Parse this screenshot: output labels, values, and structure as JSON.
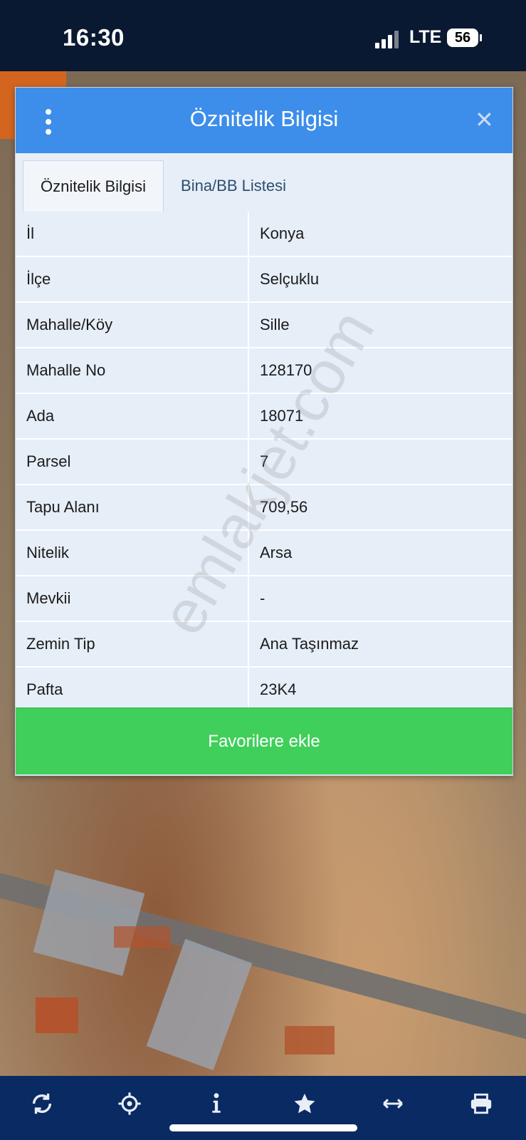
{
  "status_bar": {
    "time": "16:30",
    "network": "LTE",
    "battery": "56"
  },
  "dialog": {
    "title": "Öznitelik Bilgisi",
    "tabs": [
      {
        "label": "Öznitelik Bilgisi",
        "active": true
      },
      {
        "label": "Bina/BB Listesi",
        "active": false
      }
    ],
    "rows": [
      {
        "key": "İl",
        "value": "Konya"
      },
      {
        "key": "İlçe",
        "value": "Selçuklu"
      },
      {
        "key": "Mahalle/Köy",
        "value": "Sille"
      },
      {
        "key": "Mahalle No",
        "value": "128170"
      },
      {
        "key": "Ada",
        "value": "18071"
      },
      {
        "key": "Parsel",
        "value": "7"
      },
      {
        "key": "Tapu Alanı",
        "value": "709,56"
      },
      {
        "key": "Nitelik",
        "value": "Arsa"
      },
      {
        "key": "Mevkii",
        "value": "-"
      },
      {
        "key": "Zemin Tip",
        "value": "Ana Taşınmaz"
      },
      {
        "key": "Pafta",
        "value": "23K4"
      }
    ],
    "button_label": "Favorilere ekle",
    "watermark": "emlakjet.com"
  },
  "toolbar": {
    "icons": [
      "refresh-icon",
      "locate-icon",
      "info-icon",
      "star-icon",
      "measure-icon",
      "print-icon"
    ]
  },
  "colors": {
    "header": "#3d8eea",
    "button": "#3fcf5a",
    "toolbar": "#0a2a63"
  }
}
